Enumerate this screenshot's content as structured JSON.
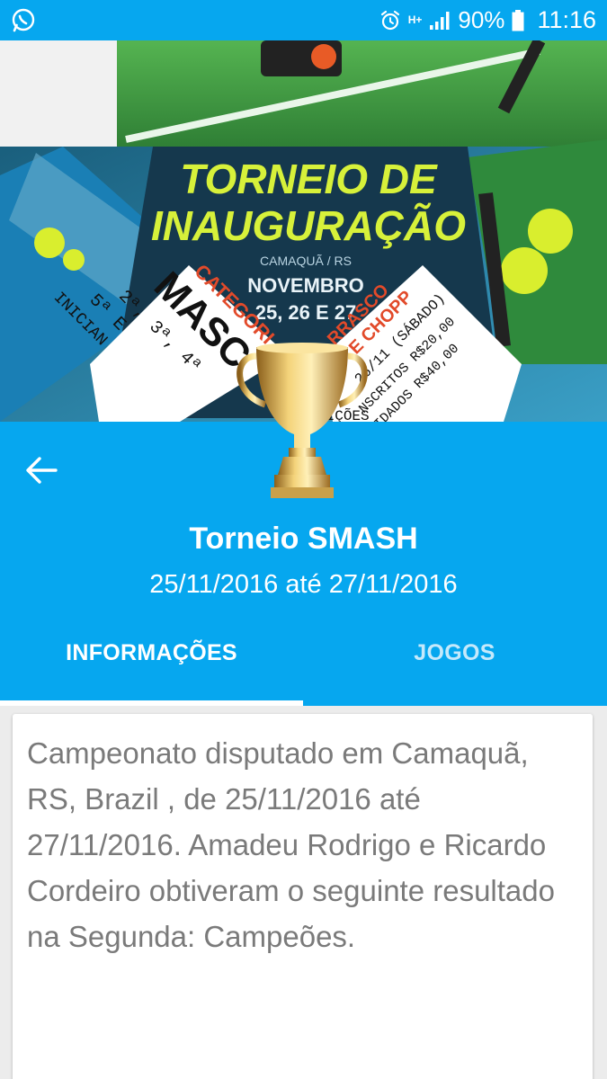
{
  "status_bar": {
    "left_icon": "whatsapp-icon",
    "network": "H+",
    "battery": "90%",
    "time": "11:16"
  },
  "banner": {
    "title_line1": "TORNEIO DE",
    "title_line2": "INAUGURAÇÃO",
    "location": "CAMAQUÃ / RS",
    "month": "NOVEMBRO",
    "days": "25, 26 E 27",
    "left_panel": [
      "CATEGORI",
      "MASC",
      "2ª, 3ª, 4ª",
      "5ª E",
      "INICIAN"
    ],
    "right_panel": [
      "RRASCO",
      "E CHOPP",
      "26/11 (SÁBADO)",
      "NSCRITOS R$20,00",
      "IDADOS R$40,00"
    ],
    "bottom_fragment": "INS CRIÇÕES"
  },
  "header": {
    "title": "Torneio SMASH",
    "dates": "25/11/2016 até 27/11/2016"
  },
  "tabs": [
    {
      "label": "INFORMAÇÕES",
      "active": true
    },
    {
      "label": "JOGOS",
      "active": false
    }
  ],
  "content": {
    "description": "Campeonato disputado em Camaquã, RS, Brazil , de 25/11/2016 até 27/11/2016. Amadeu Rodrigo e Ricardo Cordeiro obtiveram o seguinte resultado na Segunda: Campeões."
  },
  "colors": {
    "primary": "#06a7ef",
    "banner_title": "#d7f13a",
    "card_text": "#7a7a7a"
  }
}
